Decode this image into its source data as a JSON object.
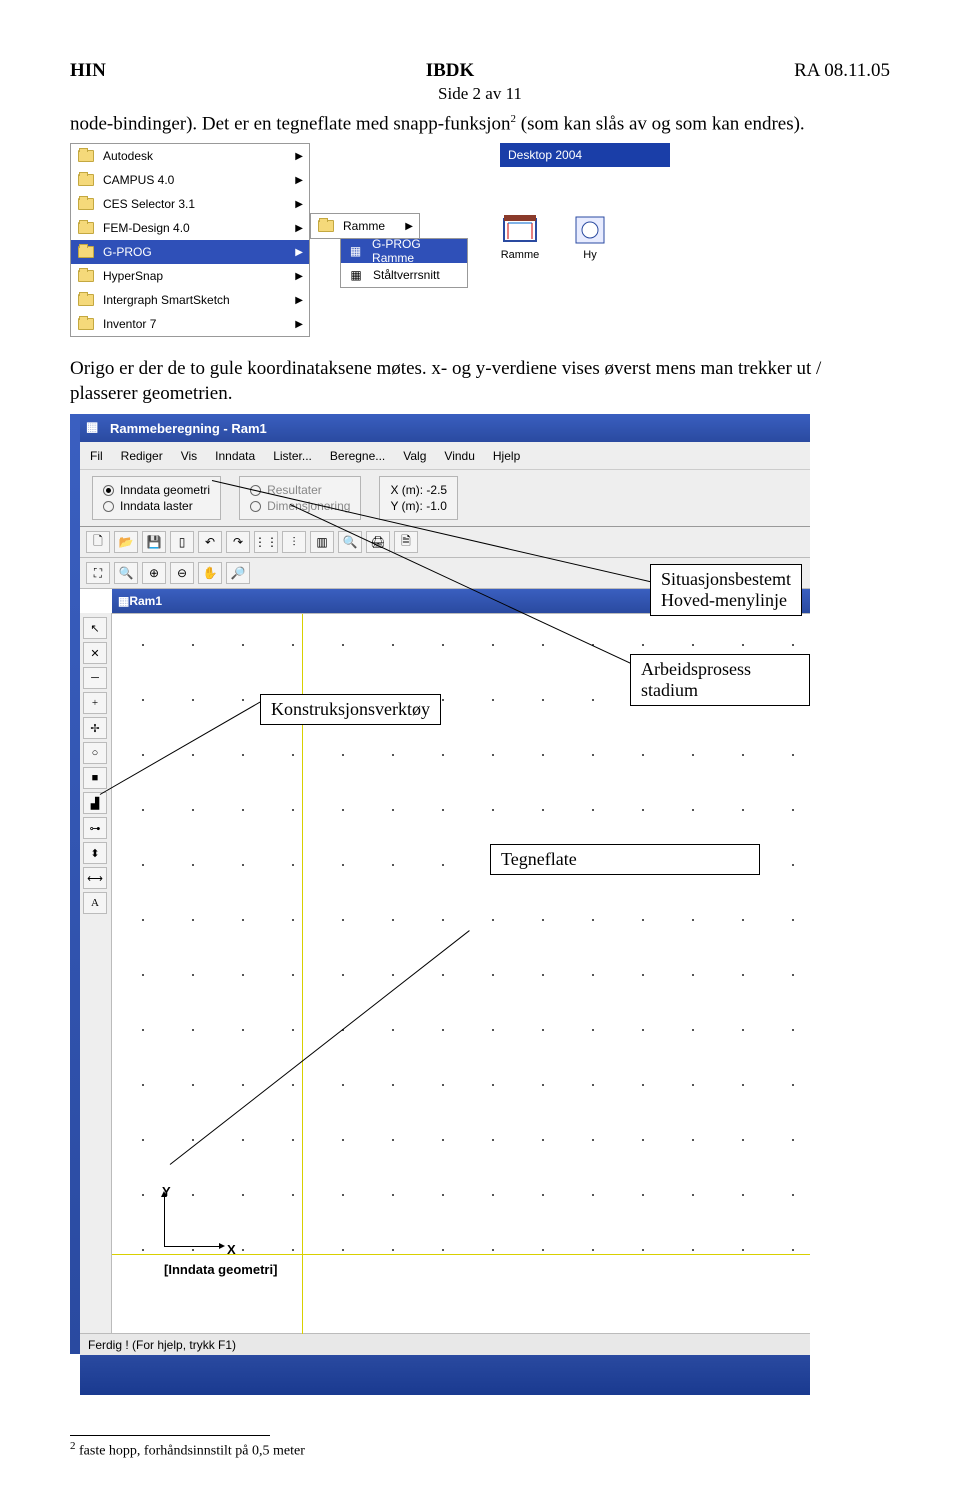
{
  "header": {
    "left": "HIN",
    "center": "IBDK",
    "right": "RA 08.11.05",
    "page": "Side 2 av 11"
  },
  "para1_a": "node-bindinger). Det er en tegneflate med snapp-funksjon",
  "para1_sup": "2",
  "para1_b": " (som kan slås av og som kan endres).",
  "startmenu": {
    "col1": [
      {
        "label": "Autodesk",
        "sel": false
      },
      {
        "label": "CAMPUS 4.0",
        "sel": false
      },
      {
        "label": "CES Selector 3.1",
        "sel": false
      },
      {
        "label": "FEM-Design 4.0",
        "sel": false
      },
      {
        "label": "G-PROG",
        "sel": true
      },
      {
        "label": "HyperSnap",
        "sel": false
      },
      {
        "label": "Intergraph SmartSketch",
        "sel": false
      },
      {
        "label": "Inventor 7",
        "sel": false
      }
    ],
    "col2": [
      {
        "label": "Ramme",
        "sel": false
      }
    ],
    "col3": [
      {
        "label": "G-PROG Ramme",
        "sel": true
      },
      {
        "label": "Ståltverrsnitt",
        "sel": false
      }
    ],
    "desktop_bar": "Desktop 2004",
    "dicons": [
      {
        "label": "Ramme"
      },
      {
        "label": "Hy"
      }
    ]
  },
  "para2": "Origo er der de to gule koordinataksene møtes. x- og y-verdiene vises øverst mens man trekker ut / plasserer geometrien.",
  "app": {
    "title": "Rammeberegning - Ram1",
    "menus": [
      "Fil",
      "Rediger",
      "Vis",
      "Inndata",
      "Lister...",
      "Beregne...",
      "Valg",
      "Vindu",
      "Hjelp"
    ],
    "radios1": {
      "a": "Inndata geometri",
      "b": "Inndata laster"
    },
    "radios2": {
      "a": "Resultater",
      "b": "Dimensjonering"
    },
    "coords": {
      "x": "X (m): -2.5",
      "y": "Y (m): -1.0"
    },
    "doc_title": "Ram1",
    "canvas_caption": "[Inndata geometri]",
    "axis_y": "Y",
    "axis_x": "X",
    "status": "Ferdig !  (For hjelp, trykk F1)"
  },
  "callouts": {
    "c1": "Situasjonsbestemt\nHoved-menylinje",
    "c2": "Arbeidsprosess stadium",
    "c3": "Konstruksjonsverktøy",
    "c4": "Tegneflate"
  },
  "footnote": {
    "num": "2",
    "text": " faste hopp, forhåndsinnstilt på 0,5 meter"
  }
}
